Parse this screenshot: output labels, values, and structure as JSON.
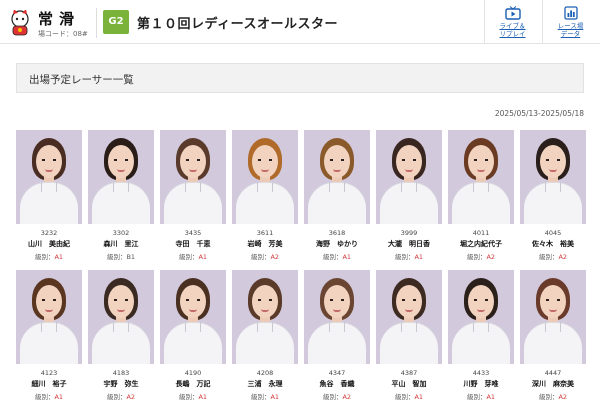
{
  "header": {
    "venue_name": "常滑",
    "venue_code": "場コード：08#",
    "grade": "G2",
    "race_title": "第１０回レディースオールスター",
    "nav": [
      {
        "label_line1": "ライブ＆",
        "label_line2": "リプレイ",
        "icon": "tv-icon"
      },
      {
        "label_line1": "レース場",
        "label_line2": "データ",
        "icon": "chart-icon"
      }
    ]
  },
  "section_title": "出場予定レーサー一覧",
  "date_range": "2025/05/13-2025/05/18",
  "class_label": "級別：",
  "racers": [
    {
      "number": "3232",
      "name": "山川　美由紀",
      "class": "A1"
    },
    {
      "number": "3302",
      "name": "森川　里江",
      "class": "B1"
    },
    {
      "number": "3435",
      "name": "寺田　千恵",
      "class": "A1"
    },
    {
      "number": "3611",
      "name": "岩崎　芳美",
      "class": "A2"
    },
    {
      "number": "3618",
      "name": "海野　ゆかり",
      "class": "A1"
    },
    {
      "number": "3999",
      "name": "大瀧　明日香",
      "class": "A1"
    },
    {
      "number": "4011",
      "name": "堀之内紀代子",
      "class": "A2"
    },
    {
      "number": "4045",
      "name": "佐々木　裕美",
      "class": "A2"
    },
    {
      "number": "4123",
      "name": "細川　裕子",
      "class": "A1"
    },
    {
      "number": "4183",
      "name": "宇野　弥生",
      "class": "A2"
    },
    {
      "number": "4190",
      "name": "長嶋　万記",
      "class": "A1"
    },
    {
      "number": "4208",
      "name": "三浦　永理",
      "class": "A1"
    },
    {
      "number": "4347",
      "name": "魚谷　香織",
      "class": "A2"
    },
    {
      "number": "4387",
      "name": "平山　智加",
      "class": "A1"
    },
    {
      "number": "4433",
      "name": "川野　芽唯",
      "class": "A1"
    },
    {
      "number": "4447",
      "name": "深川　麻奈美",
      "class": "A2"
    }
  ]
}
